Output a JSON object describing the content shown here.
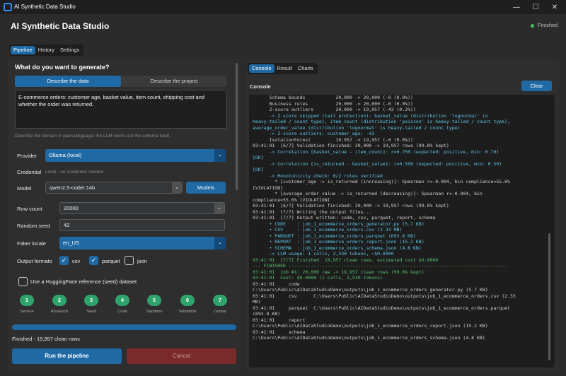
{
  "window": {
    "title": "AI Synthetic Data Studio",
    "minimize": "—",
    "maximize": "☐",
    "close": "✕"
  },
  "header": {
    "title": "AI Synthetic Data Studio",
    "status": "Finished"
  },
  "main_tabs": [
    "Pipeline",
    "History",
    "Settings"
  ],
  "left": {
    "section_title": "What do you want to generate?",
    "mode_tabs": [
      "Describe the data",
      "Describe the project"
    ],
    "prompt": "E-commerce orders: customer age, basket value, item count, shipping cost and whether the order was returned.",
    "hint": "Describe the domain in plain language; the LLM works out the schema itself.",
    "provider_label": "Provider",
    "provider_value": "Ollama (local)",
    "credential_label": "Credential",
    "credential_value": "Local - no credential needed",
    "model_label": "Model",
    "model_value": "qwen2.5-coder:14b",
    "models_button": "Models",
    "row_count_label": "Row count",
    "row_count_value": "20000",
    "seed_label": "Random seed",
    "seed_value": "42",
    "faker_label": "Faker locale",
    "faker_value": "en_US",
    "output_label": "Output formats",
    "formats": [
      {
        "label": "csv",
        "checked": true
      },
      {
        "label": "parquet",
        "checked": true
      },
      {
        "label": "json",
        "checked": false
      }
    ],
    "hf_label": "Use a HuggingFace reference (seed) dataset",
    "steps": [
      {
        "num": "1",
        "label": "Service"
      },
      {
        "num": "2",
        "label": "Research"
      },
      {
        "num": "3",
        "label": "Seed"
      },
      {
        "num": "4",
        "label": "Code"
      },
      {
        "num": "5",
        "label": "Sandbox"
      },
      {
        "num": "6",
        "label": "Validation"
      },
      {
        "num": "7",
        "label": "Output"
      }
    ],
    "progress": 1.0,
    "status": "Finished - 19,957 clean rows",
    "run_button": "Run the pipeline",
    "cancel_button": "Cancel"
  },
  "right": {
    "tabs": [
      "Console",
      "Result",
      "Charts"
    ],
    "console_title": "Console",
    "clear_button": "Clear",
    "lines": [
      {
        "t": "      Schema bounds           20,000 -> 20,000 (-0 (0.0%))",
        "c": ""
      },
      {
        "t": "      Business rules          20,000 -> 20,000 (-0 (0.0%))",
        "c": ""
      },
      {
        "t": "      Z-score outliers        20,000 -> 19,957 (-43 (0.2%))",
        "c": ""
      },
      {
        "t": "      -> Z-score skipped (tail protection): basket_value (distribution 'lognormal' is",
        "c": "c-cyan"
      },
      {
        "t": "heavy-tailed / count type), item_count (distribution 'poisson' is heavy-tailed / count type),",
        "c": "c-cyan"
      },
      {
        "t": "average_order_value (distribution 'lognormal' is heavy-tailed / count type)",
        "c": "c-cyan"
      },
      {
        "t": "      -> Z-score outliers: customer_age: -43",
        "c": "c-cyan"
      },
      {
        "t": "      IsolationForest         19,957 -> 19,957 (-0 (0.0%))",
        "c": ""
      },
      {
        "t": "03:41:01  [6/7] Validation finished: 20,000 -> 19,957 rows (99.8% kept)",
        "c": ""
      },
      {
        "t": "      -> Correlation [basket_value - item_count]: r=0.750 (expected: positive, min: 0.70)",
        "c": "c-cyan"
      },
      {
        "t": "[OK]",
        "c": "c-cyan"
      },
      {
        "t": "      -> Correlation [is_returned - basket_value]: r=0.550 (expected: positive, min: 0.50)",
        "c": "c-cyan"
      },
      {
        "t": "[OK]",
        "c": "c-cyan"
      },
      {
        "t": "      -> Monotonicity check: 0/2 rules verified",
        "c": "c-cyan"
      },
      {
        "t": "        * [customer_age -> is_returned (increasing)]: Spearman r=-0.004, bin compliance=55.6%",
        "c": ""
      },
      {
        "t": "[VIOLATION]",
        "c": ""
      },
      {
        "t": "        * [average_order_value -> is_returned (decreasing)]: Spearman r=-0.004, bin",
        "c": ""
      },
      {
        "t": "compliance=55.6% [VIOLATION]",
        "c": ""
      },
      {
        "t": "03:41:01  [6/7] Validation finished: 20,000 -> 19,957 rows (99.8% kept)",
        "c": ""
      },
      {
        "t": "03:41:01  [7/7] Writing the output files...",
        "c": ""
      },
      {
        "t": "03:41:01  [7/7] Output written: code, csv, parquet, report, schema",
        "c": ""
      },
      {
        "t": "      • CODE    : job_1_ecommerce_orders_generator.py (5.7 KB)",
        "c": "c-cyan"
      },
      {
        "t": "      • CSV     : job_1_ecommerce_orders.csv (2.33 MB)",
        "c": "c-cyan"
      },
      {
        "t": "      • PARQUET : job_1_ecommerce_orders.parquet (693.8 KB)",
        "c": "c-cyan"
      },
      {
        "t": "      • REPORT  : job_1_ecommerce_orders_report.json (15.2 KB)",
        "c": "c-cyan"
      },
      {
        "t": "      • SCHEMA  : job_1_ecommerce_orders_schema.json (4.8 KB)",
        "c": "c-cyan"
      },
      {
        "t": "      -> LLM usage: 1 calls, 2,530 tokens, ~$0.0000",
        "c": "c-cyan"
      },
      {
        "t": "03:41:01  [7/7] Finished. 19,957 clean rows, estimated cost $0.0000",
        "c": "c-green"
      },
      {
        "t": "--- FINISHED -------------------------------------------------------------------------------",
        "c": "c-green"
      },
      {
        "t": "03:41:01  Job #1: 20,000 raw -> 19,957 clean rows (99.8% kept)",
        "c": "c-green"
      },
      {
        "t": "03:41:01  Cost: $0.0000 (1 calls, 2,530 tokens)",
        "c": "c-green"
      },
      {
        "t": "03:41:01     code",
        "c": ""
      },
      {
        "t": "C:\\Users\\Public\\AIDataStudioDemo\\outputs\\job_1_ecommerce_orders_generator.py (5.7 KB)",
        "c": ""
      },
      {
        "t": "03:41:01     csv      C:\\Users\\Public\\AIDataStudioDemo\\outputs\\job_1_ecommerce_orders.csv (2.33",
        "c": ""
      },
      {
        "t": "MB)",
        "c": ""
      },
      {
        "t": "03:41:01     parquet  C:\\Users\\Public\\AIDataStudioDemo\\outputs\\job_1_ecommerce_orders.parquet",
        "c": ""
      },
      {
        "t": "(693.8 KB)",
        "c": ""
      },
      {
        "t": "03:41:01     report",
        "c": ""
      },
      {
        "t": "C:\\Users\\Public\\AIDataStudioDemo\\outputs\\job_1_ecommerce_orders_report.json (15.2 KB)",
        "c": ""
      },
      {
        "t": "03:41:01     schema",
        "c": ""
      },
      {
        "t": "C:\\Users\\Public\\AIDataStudioDemo\\outputs\\job_1_ecommerce_orders_schema.json (4.8 KB)",
        "c": ""
      }
    ]
  }
}
